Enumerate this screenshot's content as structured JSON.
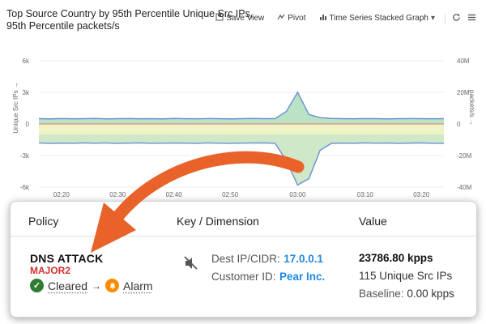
{
  "chart_panel": {
    "title": "Top Source Country by 95th Percentile Unique Src IPs, 95th Percentile packets/s",
    "toolbar": {
      "save_view_label": "Save View",
      "pivot_label": "Pivot",
      "view_type_label": "Time Series Stacked Graph"
    }
  },
  "chart_data": {
    "type": "area",
    "x": [
      "02:16",
      "02:18",
      "02:20",
      "02:22",
      "02:24",
      "02:26",
      "02:28",
      "02:30",
      "02:32",
      "02:34",
      "02:36",
      "02:38",
      "02:40",
      "02:42",
      "02:44",
      "02:46",
      "02:48",
      "02:50",
      "02:52",
      "02:54",
      "02:56",
      "02:58",
      "02:59",
      "03:00",
      "03:01",
      "03:02",
      "03:04",
      "03:06",
      "03:08",
      "03:10",
      "03:12",
      "03:14",
      "03:16",
      "03:18",
      "03:20",
      "03:22",
      "03:24"
    ],
    "series": [
      {
        "values": [
          500,
          480,
          510,
          490,
          500,
          520,
          480,
          500,
          510,
          490,
          500,
          480,
          520,
          500,
          490,
          510,
          500,
          480,
          500,
          520,
          500,
          500,
          1200,
          3000,
          900,
          600,
          520,
          500,
          490,
          510,
          500,
          480,
          500,
          510,
          500,
          490,
          500
        ]
      },
      {
        "values": [
          -1800,
          -1850,
          -1820,
          -1840,
          -1800,
          -1830,
          -1810,
          -1850,
          -1820,
          -1800,
          -1840,
          -1830,
          -1810,
          -1820,
          -1850,
          -1800,
          -1830,
          -1840,
          -1820,
          -1810,
          -1800,
          -1850,
          -3500,
          -5800,
          -5200,
          -2500,
          -1850,
          -1820,
          -1840,
          -1800,
          -1830,
          -1810,
          -1850,
          -1820,
          -1800,
          -1840,
          -1850
        ]
      }
    ],
    "x_ticks": [
      "02:20",
      "02:30",
      "02:40",
      "02:50",
      "03:00",
      "03:10",
      "03:20"
    ],
    "y_left_ticks": [
      "6k",
      "3k",
      "0",
      "-3k",
      "-6k"
    ],
    "y_right_ticks": [
      "40M",
      "20M",
      "0",
      "-20M",
      "-40M"
    ],
    "y_left_label": "Unique Src IPs →",
    "y_right_label": "packets/s →",
    "ylim": [
      -6000,
      6000
    ],
    "grid": true,
    "colors": {
      "upper": "#b9e3c4",
      "lower": "#cfe8c7",
      "lower_band": "#f2f5c6",
      "line": "#6a8fd8",
      "zero": "#e57373"
    }
  },
  "table": {
    "headers": {
      "policy": "Policy",
      "key": "Key / Dimension",
      "value": "Value"
    },
    "row": {
      "policy_name": "DNS ATTACK",
      "severity": "MAJOR2",
      "from_state": "Cleared",
      "to_state": "Alarm",
      "dim1_label": "Dest IP/CIDR:",
      "dim1_value": "17.0.0.1",
      "dim2_label": "Customer ID:",
      "dim2_value": "Pear Inc.",
      "value_main": "23786.80 kpps",
      "value_unique": "115 Unique Src IPs",
      "baseline_label": "Baseline:",
      "baseline_value": "0.00 kpps"
    }
  },
  "icons": [
    "save-icon",
    "pivot-icon",
    "bar-chart-icon",
    "chevron-down-icon",
    "refresh-icon",
    "menu-icon",
    "check-icon",
    "alarm-icon",
    "mute-icon"
  ],
  "accent_arrow_color": "#e8622a"
}
